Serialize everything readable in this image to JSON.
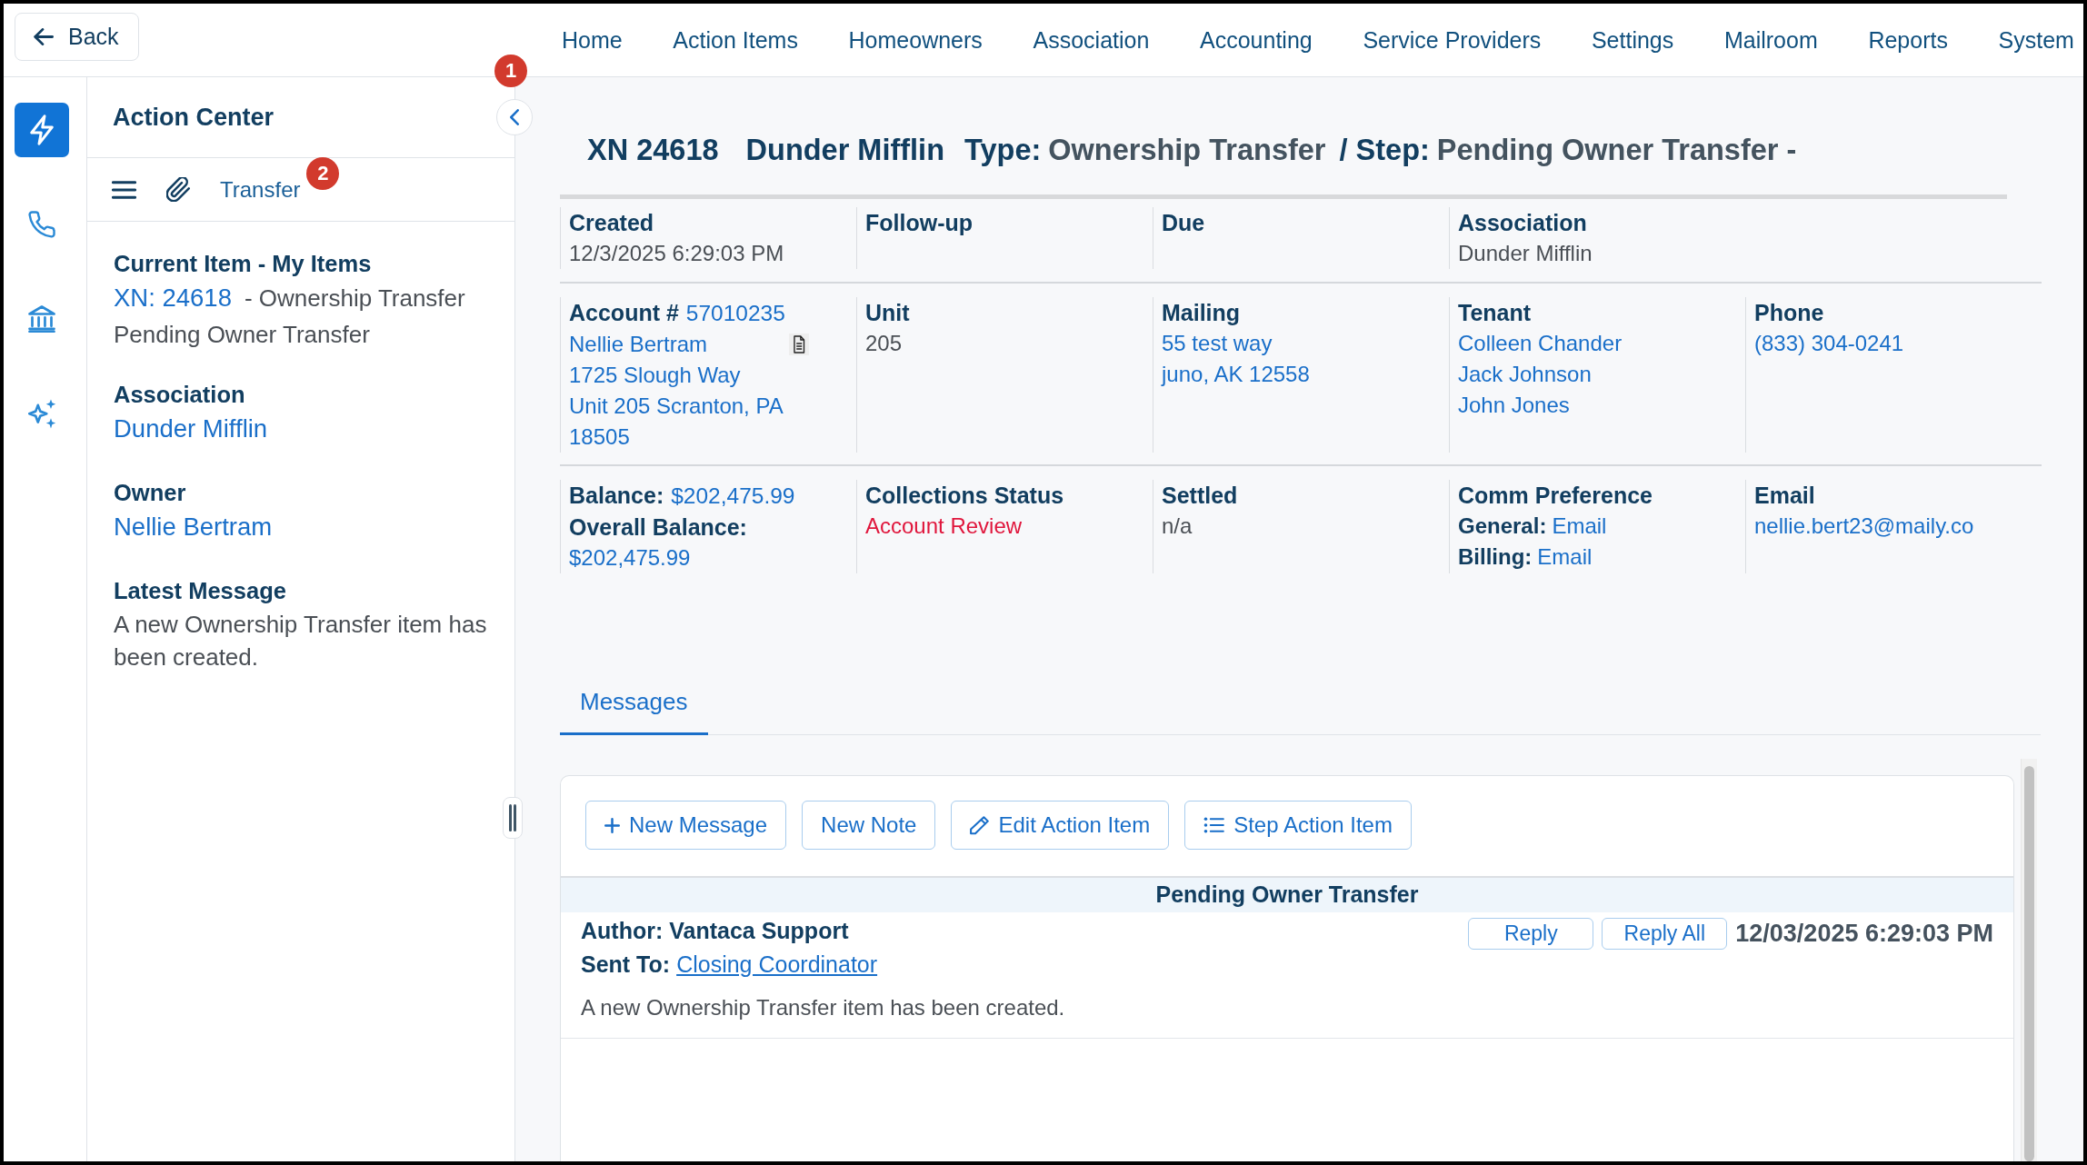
{
  "top_bar": {
    "back_button": "Back",
    "nav": [
      "Home",
      "Action Items",
      "Homeowners",
      "Association",
      "Accounting",
      "Service Providers",
      "Settings",
      "Mailroom",
      "Reports",
      "System"
    ]
  },
  "icon_rail": [
    {
      "kind": "bolt",
      "selected": true
    },
    {
      "kind": "phone",
      "selected": false
    },
    {
      "kind": "bank",
      "selected": false
    },
    {
      "kind": "sparkles",
      "selected": false
    }
  ],
  "action_center": {
    "title": "Action Center",
    "collapse_badge": "1",
    "toolbar": {
      "tab_label": "Transfer",
      "badge": "2"
    },
    "sections": [
      {
        "heading": "Current Item - My Items",
        "link": "XN: 24618",
        "text": "- Ownership Transfer",
        "note": "Pending Owner Transfer"
      },
      {
        "heading": "Association",
        "link": "Dunder Mifflin"
      },
      {
        "heading": "Owner",
        "link": "Nellie Bertram"
      },
      {
        "heading": "Latest Message",
        "note": "A new Ownership Transfer item has been created."
      }
    ]
  },
  "item": {
    "title": {
      "number": "XN 24618",
      "association": "Dunder Mifflin",
      "type_label": "Type:",
      "type": "Ownership Transfer",
      "step_label": "/ Step:",
      "step": "Pending Owner Transfer -"
    },
    "rows": [
      {
        "cells": [
          {
            "heading": "Created",
            "lines": [
              {
                "kind": "text",
                "value": "12/3/2025 6:29:03 PM"
              }
            ]
          },
          {
            "heading": "Follow-up"
          },
          {
            "heading": "Due"
          },
          {
            "heading": "Association",
            "lines": [
              {
                "kind": "text",
                "value": "Dunder Mifflin"
              }
            ]
          }
        ]
      },
      {
        "cells": [
          {
            "heading": "Account #",
            "heading_link": "57010235",
            "lines": [
              {
                "kind": "filelink",
                "value": "Nellie Bertram"
              },
              {
                "kind": "link",
                "value": "1725 Slough Way"
              },
              {
                "kind": "link",
                "value": "Unit 205 Scranton, PA"
              },
              {
                "kind": "link",
                "value": "18505"
              }
            ]
          },
          {
            "heading": "Unit",
            "lines": [
              {
                "kind": "text",
                "value": "205"
              }
            ]
          },
          {
            "heading": "Mailing",
            "lines": [
              {
                "kind": "link",
                "value": "55 test way"
              },
              {
                "kind": "link",
                "value": "juno, AK 12558"
              }
            ]
          },
          {
            "heading": "Tenant",
            "lines": [
              {
                "kind": "link",
                "value": "Colleen Chander"
              },
              {
                "kind": "link",
                "value": "Jack Johnson"
              },
              {
                "kind": "link",
                "value": "John Jones"
              }
            ]
          },
          {
            "heading": "Phone",
            "lines": [
              {
                "kind": "link",
                "value": "(833) 304-0241"
              }
            ]
          }
        ]
      },
      {
        "cells": [
          {
            "heading": "Balance:",
            "heading_link": "$202,475.99",
            "lines": [
              {
                "kind": "label",
                "value": "Overall Balance:"
              },
              {
                "kind": "link",
                "value": "$202,475.99"
              }
            ]
          },
          {
            "heading": "Collections Status",
            "lines": [
              {
                "kind": "alert",
                "value": "Account Review"
              }
            ]
          },
          {
            "heading": "Settled",
            "lines": [
              {
                "kind": "text",
                "value": "n/a"
              }
            ]
          },
          {
            "heading": "Comm Preference",
            "lines": [
              {
                "kind": "link",
                "label": "General:",
                "value": "Email"
              },
              {
                "kind": "link",
                "label": "Billing:",
                "value": "Email"
              }
            ]
          },
          {
            "heading": "Email",
            "lines": [
              {
                "kind": "link",
                "value": "nellie.bert23@maily.co"
              }
            ]
          }
        ]
      }
    ]
  },
  "tabs": [
    {
      "label": "Messages",
      "selected": true
    }
  ],
  "message_panel": {
    "buttons": [
      {
        "label": "New Message",
        "kind": "compose"
      },
      {
        "label": "New Note",
        "kind": "note"
      },
      {
        "label": "Edit Action Item",
        "kind": "edit"
      },
      {
        "label": "Step Action Item",
        "kind": "steps"
      }
    ],
    "messages": [
      {
        "subject": "Pending Owner Transfer",
        "author": "Author: Vantaca Support",
        "sent_to_label": "Sent To:",
        "sent_to": "Closing Coordinator",
        "actions": [
          "Reply",
          "Reply All"
        ],
        "date": "12/03/2025 6:29:03 PM",
        "body": "A new Ownership Transfer item has been created."
      }
    ]
  }
}
